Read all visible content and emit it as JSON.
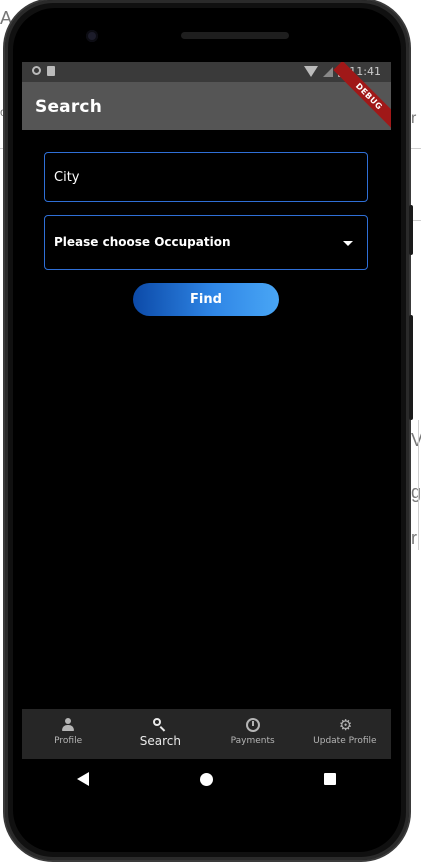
{
  "app": {
    "title": "Search",
    "debug_banner": "DEBUG"
  },
  "status_bar": {
    "time": "11:41"
  },
  "form": {
    "city_placeholder": "City",
    "occupation_value": "Please choose Occupation",
    "find_label": "Find"
  },
  "bottom_nav": {
    "items": [
      {
        "label": "Profile",
        "icon": "person-icon",
        "active": false
      },
      {
        "label": "Search",
        "icon": "search-icon",
        "active": true
      },
      {
        "label": "Payments",
        "icon": "history-icon",
        "active": false
      },
      {
        "label": "Update Profile",
        "icon": "gear-icon",
        "active": false
      }
    ]
  },
  "colors": {
    "field_border": "#2f6fd6",
    "appbar": "#555555",
    "nav_bg": "#262626",
    "button_gradient_start": "#0c4aa8",
    "button_gradient_end": "#49a6f5",
    "debug_ribbon": "#a01818"
  }
}
